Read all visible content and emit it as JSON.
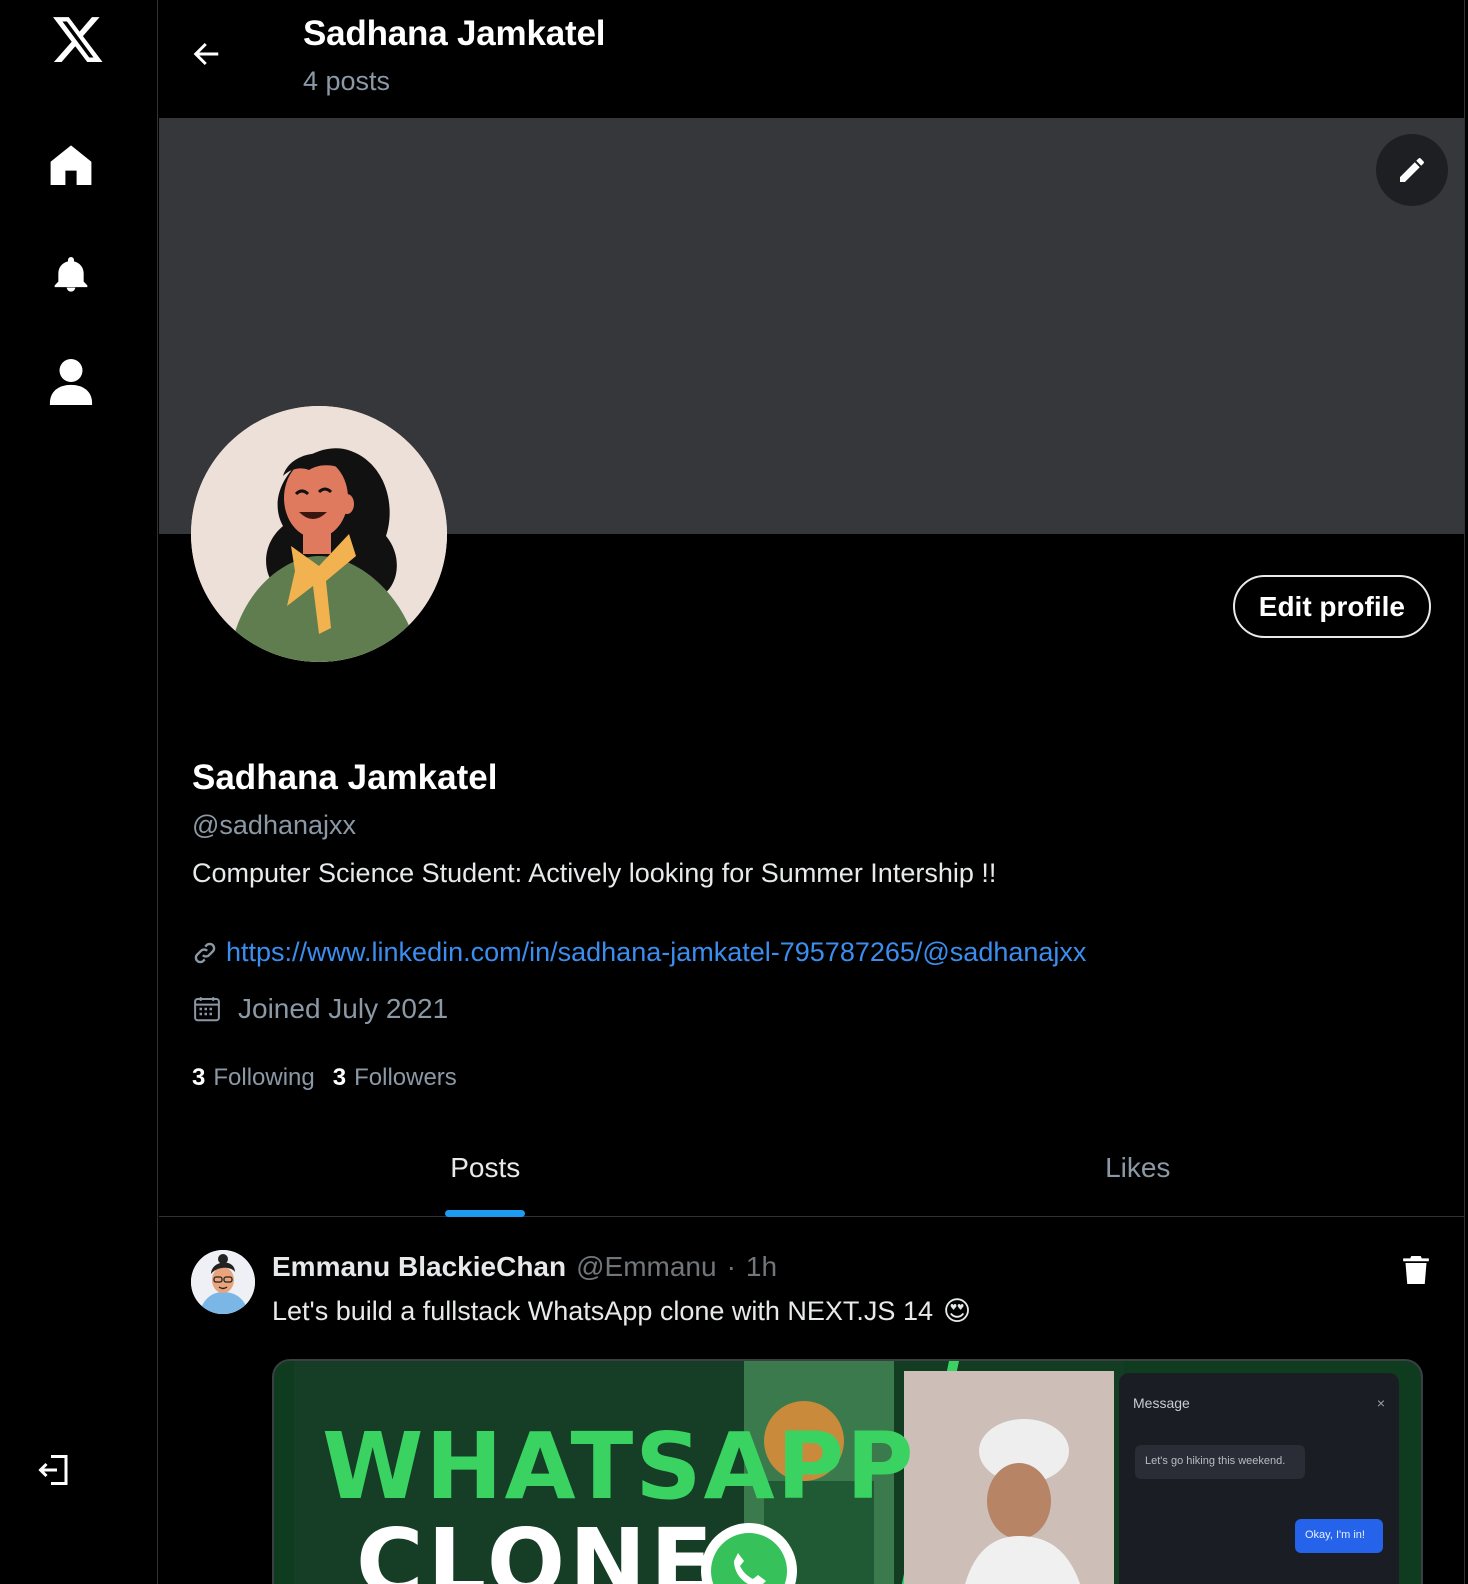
{
  "nav": {
    "items": [
      {
        "icon": "x-logo-icon"
      },
      {
        "icon": "home-icon"
      },
      {
        "icon": "bell-icon"
      },
      {
        "icon": "user-icon"
      },
      {
        "icon": "logout-icon"
      }
    ]
  },
  "header": {
    "name": "Sadhana Jamkatel",
    "post_count": "4 posts"
  },
  "profile": {
    "display_name": "Sadhana Jamkatel",
    "handle": "@sadhanajxx",
    "bio": "Computer Science Student: Actively looking for Summer Intership !!",
    "website": "https://www.linkedin.com/in/sadhana-jamkatel-795787265/@sadhanajxx",
    "joined": "Joined July 2021",
    "following_count": "3",
    "following_label": "Following",
    "followers_count": "3",
    "followers_label": "Followers",
    "edit_label": "Edit profile"
  },
  "tabs": [
    {
      "label": "Posts",
      "active": true
    },
    {
      "label": "Likes",
      "active": false
    }
  ],
  "post": {
    "author": "Emmanu BlackieChan",
    "handle": "@Emmanu",
    "separator": "·",
    "time": "1h",
    "text": "Let's build a fullstack WhatsApp clone with NEXT.JS 14",
    "emoji": "😍",
    "media": {
      "headline_1": "WHATSAPP",
      "headline_2": "CLONE",
      "panel_title": "Message",
      "panel_close": "×",
      "bubble_in": "Let's go hiking this weekend.",
      "bubble_out": "Okay, I'm in!"
    }
  },
  "colors": {
    "background": "#000000",
    "banner": "#36373b",
    "link": "#3b8ef0",
    "tab_indicator": "#1d9bf0",
    "muted_text": "#8b98a5"
  }
}
